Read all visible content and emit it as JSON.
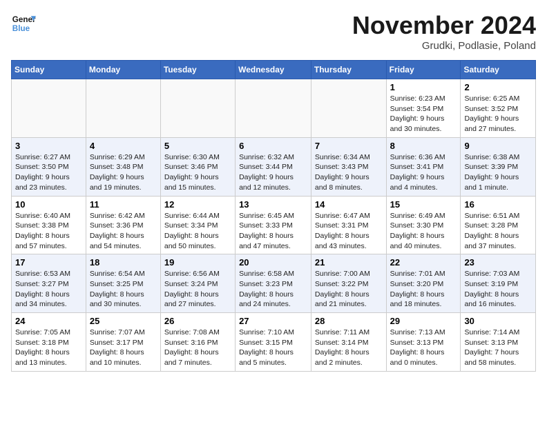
{
  "header": {
    "logo_line1": "General",
    "logo_line2": "Blue",
    "month": "November 2024",
    "location": "Grudki, Podlasie, Poland"
  },
  "weekdays": [
    "Sunday",
    "Monday",
    "Tuesday",
    "Wednesday",
    "Thursday",
    "Friday",
    "Saturday"
  ],
  "weeks": [
    [
      {
        "day": "",
        "detail": ""
      },
      {
        "day": "",
        "detail": ""
      },
      {
        "day": "",
        "detail": ""
      },
      {
        "day": "",
        "detail": ""
      },
      {
        "day": "",
        "detail": ""
      },
      {
        "day": "1",
        "detail": "Sunrise: 6:23 AM\nSunset: 3:54 PM\nDaylight: 9 hours and 30 minutes."
      },
      {
        "day": "2",
        "detail": "Sunrise: 6:25 AM\nSunset: 3:52 PM\nDaylight: 9 hours and 27 minutes."
      }
    ],
    [
      {
        "day": "3",
        "detail": "Sunrise: 6:27 AM\nSunset: 3:50 PM\nDaylight: 9 hours and 23 minutes."
      },
      {
        "day": "4",
        "detail": "Sunrise: 6:29 AM\nSunset: 3:48 PM\nDaylight: 9 hours and 19 minutes."
      },
      {
        "day": "5",
        "detail": "Sunrise: 6:30 AM\nSunset: 3:46 PM\nDaylight: 9 hours and 15 minutes."
      },
      {
        "day": "6",
        "detail": "Sunrise: 6:32 AM\nSunset: 3:44 PM\nDaylight: 9 hours and 12 minutes."
      },
      {
        "day": "7",
        "detail": "Sunrise: 6:34 AM\nSunset: 3:43 PM\nDaylight: 9 hours and 8 minutes."
      },
      {
        "day": "8",
        "detail": "Sunrise: 6:36 AM\nSunset: 3:41 PM\nDaylight: 9 hours and 4 minutes."
      },
      {
        "day": "9",
        "detail": "Sunrise: 6:38 AM\nSunset: 3:39 PM\nDaylight: 9 hours and 1 minute."
      }
    ],
    [
      {
        "day": "10",
        "detail": "Sunrise: 6:40 AM\nSunset: 3:38 PM\nDaylight: 8 hours and 57 minutes."
      },
      {
        "day": "11",
        "detail": "Sunrise: 6:42 AM\nSunset: 3:36 PM\nDaylight: 8 hours and 54 minutes."
      },
      {
        "day": "12",
        "detail": "Sunrise: 6:44 AM\nSunset: 3:34 PM\nDaylight: 8 hours and 50 minutes."
      },
      {
        "day": "13",
        "detail": "Sunrise: 6:45 AM\nSunset: 3:33 PM\nDaylight: 8 hours and 47 minutes."
      },
      {
        "day": "14",
        "detail": "Sunrise: 6:47 AM\nSunset: 3:31 PM\nDaylight: 8 hours and 43 minutes."
      },
      {
        "day": "15",
        "detail": "Sunrise: 6:49 AM\nSunset: 3:30 PM\nDaylight: 8 hours and 40 minutes."
      },
      {
        "day": "16",
        "detail": "Sunrise: 6:51 AM\nSunset: 3:28 PM\nDaylight: 8 hours and 37 minutes."
      }
    ],
    [
      {
        "day": "17",
        "detail": "Sunrise: 6:53 AM\nSunset: 3:27 PM\nDaylight: 8 hours and 34 minutes."
      },
      {
        "day": "18",
        "detail": "Sunrise: 6:54 AM\nSunset: 3:25 PM\nDaylight: 8 hours and 30 minutes."
      },
      {
        "day": "19",
        "detail": "Sunrise: 6:56 AM\nSunset: 3:24 PM\nDaylight: 8 hours and 27 minutes."
      },
      {
        "day": "20",
        "detail": "Sunrise: 6:58 AM\nSunset: 3:23 PM\nDaylight: 8 hours and 24 minutes."
      },
      {
        "day": "21",
        "detail": "Sunrise: 7:00 AM\nSunset: 3:22 PM\nDaylight: 8 hours and 21 minutes."
      },
      {
        "day": "22",
        "detail": "Sunrise: 7:01 AM\nSunset: 3:20 PM\nDaylight: 8 hours and 18 minutes."
      },
      {
        "day": "23",
        "detail": "Sunrise: 7:03 AM\nSunset: 3:19 PM\nDaylight: 8 hours and 16 minutes."
      }
    ],
    [
      {
        "day": "24",
        "detail": "Sunrise: 7:05 AM\nSunset: 3:18 PM\nDaylight: 8 hours and 13 minutes."
      },
      {
        "day": "25",
        "detail": "Sunrise: 7:07 AM\nSunset: 3:17 PM\nDaylight: 8 hours and 10 minutes."
      },
      {
        "day": "26",
        "detail": "Sunrise: 7:08 AM\nSunset: 3:16 PM\nDaylight: 8 hours and 7 minutes."
      },
      {
        "day": "27",
        "detail": "Sunrise: 7:10 AM\nSunset: 3:15 PM\nDaylight: 8 hours and 5 minutes."
      },
      {
        "day": "28",
        "detail": "Sunrise: 7:11 AM\nSunset: 3:14 PM\nDaylight: 8 hours and 2 minutes."
      },
      {
        "day": "29",
        "detail": "Sunrise: 7:13 AM\nSunset: 3:13 PM\nDaylight: 8 hours and 0 minutes."
      },
      {
        "day": "30",
        "detail": "Sunrise: 7:14 AM\nSunset: 3:13 PM\nDaylight: 7 hours and 58 minutes."
      }
    ]
  ]
}
